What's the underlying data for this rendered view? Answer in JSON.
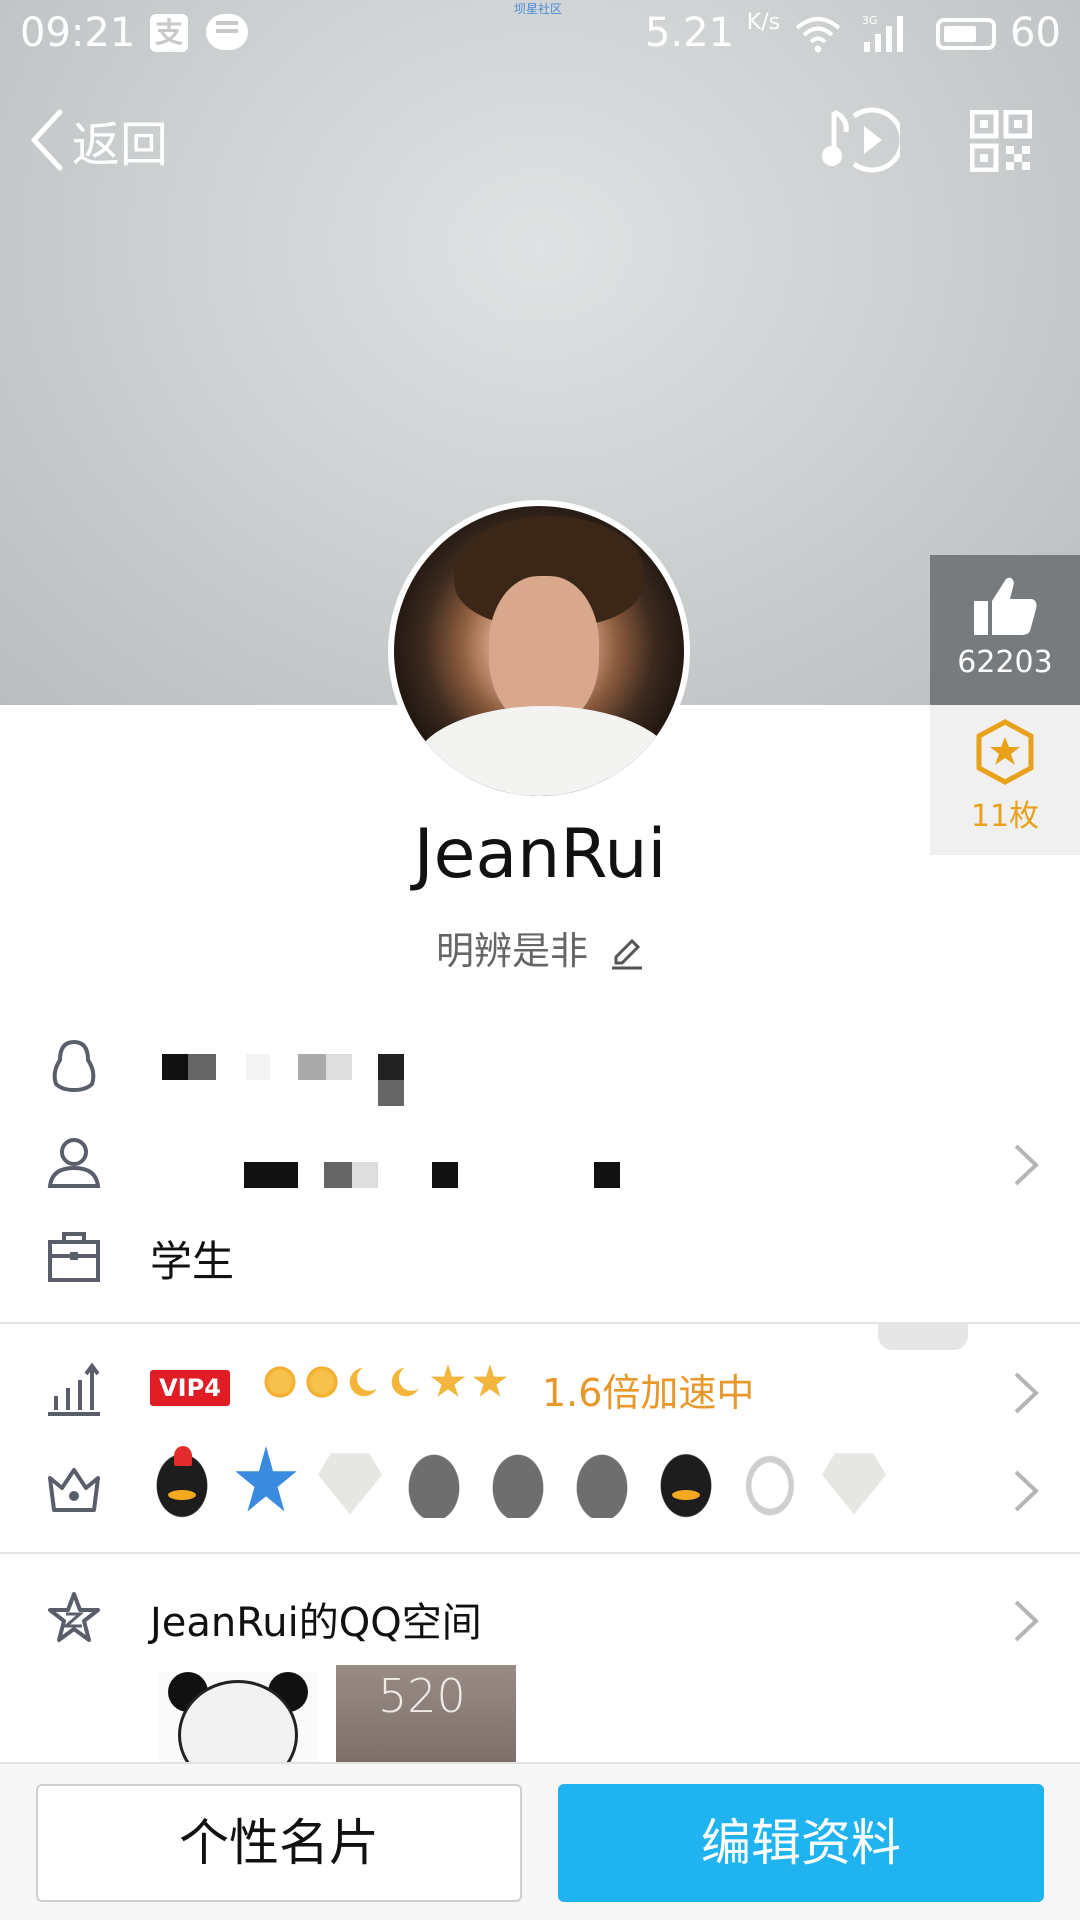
{
  "status_bar": {
    "time": "09:21",
    "carrier_label": "坝星社区",
    "speed_value": "5.21",
    "speed_unit": "K/s",
    "network": "3G",
    "battery": "60"
  },
  "nav": {
    "back_label": "返回"
  },
  "likes": {
    "count": "62203"
  },
  "medals": {
    "count": "11枚"
  },
  "profile": {
    "nickname": "JeanRui",
    "signature": "明辨是非"
  },
  "info": {
    "occupation": "学生"
  },
  "vip": {
    "badge": "VIP4",
    "speed_text": "1.6倍加速中",
    "level_icons": [
      "sun",
      "sun",
      "moon",
      "moon",
      "star",
      "star"
    ]
  },
  "badges": [
    "peng-red",
    "blue-star-5",
    "gem-lv1",
    "gray-peng",
    "gray-peng",
    "gray-peng",
    "gray-peng-crown",
    "cloud-vip2",
    "gem-lv1"
  ],
  "badge_labels": {
    "star_level": "5",
    "gem_level": "LV1",
    "cloud_vip": "VIP2"
  },
  "qzone": {
    "title": "JeanRui的QQ空间",
    "thumb2_number": "520"
  },
  "buttons": {
    "card": "个性名片",
    "edit": "编辑资料"
  },
  "colors": {
    "accent": "#1fb3ef",
    "vip_red": "#e01d25",
    "speed_orange": "#e8982a",
    "medal_gold": "#e9a11c"
  }
}
